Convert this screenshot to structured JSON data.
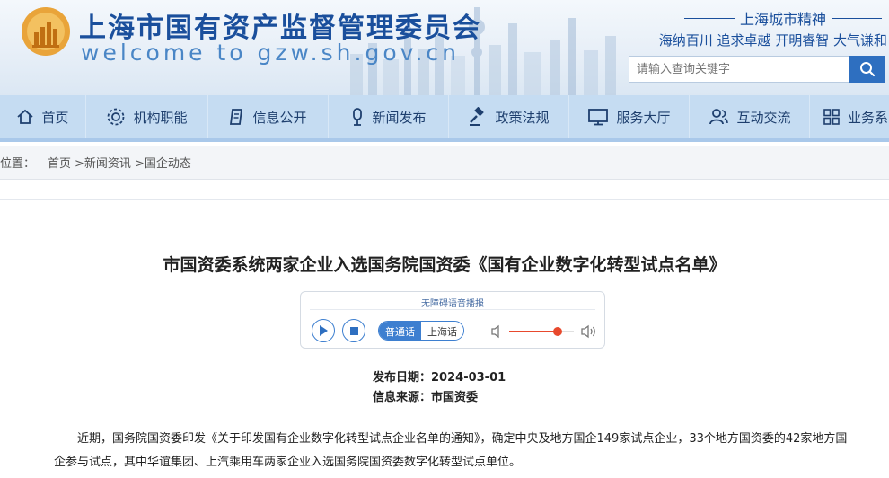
{
  "header": {
    "site_title": "上海市国有资产监督管理委员会",
    "site_url": "welcome to gzw.sh.gov.cn",
    "spirit_title": "上海城市精神",
    "spirit_text": "海纳百川 追求卓越 开明睿智 大气谦和",
    "search_placeholder": "请输入查询关键字",
    "brand_color": "#1a4f9c"
  },
  "nav": {
    "items": [
      {
        "label": "首页",
        "icon": "home-icon"
      },
      {
        "label": "机构职能",
        "icon": "gear-icon"
      },
      {
        "label": "信息公开",
        "icon": "document-icon"
      },
      {
        "label": "新闻发布",
        "icon": "microphone-icon"
      },
      {
        "label": "政策法规",
        "icon": "gavel-icon"
      },
      {
        "label": "服务大厅",
        "icon": "monitor-icon"
      },
      {
        "label": "互动交流",
        "icon": "people-icon"
      },
      {
        "label": "业务系",
        "icon": "grid-icon"
      }
    ]
  },
  "breadcrumb": {
    "prefix": "位置：",
    "items": [
      "首页",
      ">新闻资讯",
      ">国企动态"
    ]
  },
  "article": {
    "title": "市国资委系统两家企业入选国务院国资委《国有企业数字化转型试点名单》",
    "player": {
      "caption": "无障碍语音播报",
      "lang_mandarin": "普通话",
      "lang_shanghai": "上海话",
      "volume": 0.75
    },
    "date_label": "发布日期：",
    "date_value": "2024-03-01",
    "source_label": "信息来源：",
    "source_value": "市国资委",
    "body": "近期，国务院国资委印发《关于印发国有企业数字化转型试点企业名单的通知》，确定中央及地方国企149家试点企业，33个地方国资委的42家地方国企参与试点，其中华谊集团、上汽乘用车两家企业入选国务院国资委数字化转型试点单位。"
  }
}
